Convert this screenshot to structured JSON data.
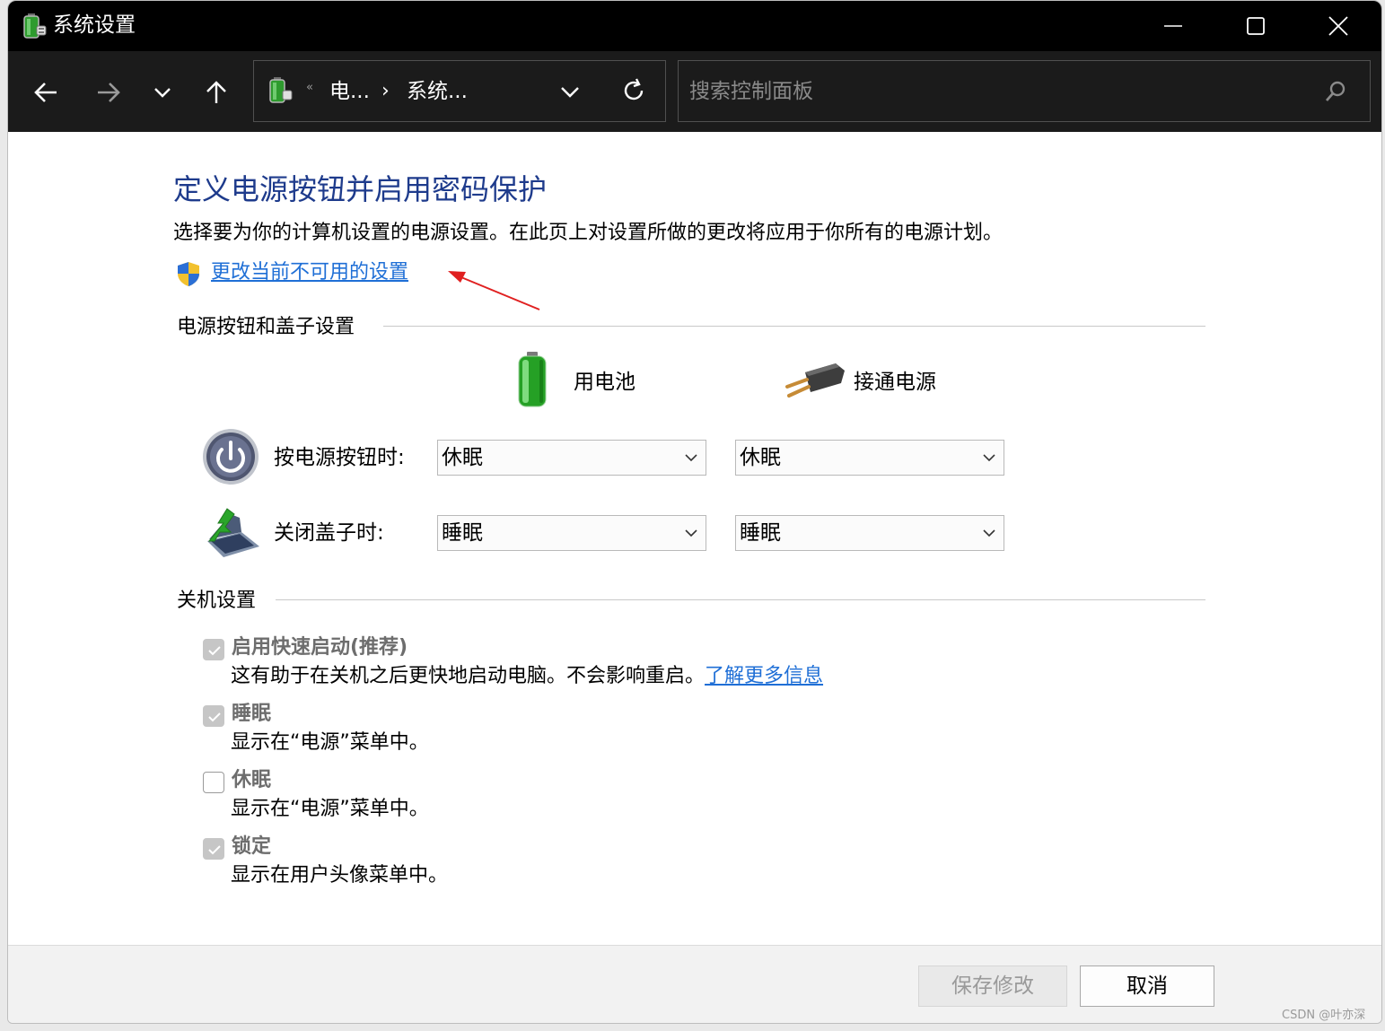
{
  "window": {
    "title": "系统设置",
    "controls": [
      "minimize",
      "maximize",
      "close"
    ]
  },
  "navbar": {
    "address": {
      "overflow": "«",
      "crumb1": "电...",
      "separator": "›",
      "crumb2": "系统..."
    },
    "search_placeholder": "搜索控制面板"
  },
  "content": {
    "heading": "定义电源按钮并启用密码保护",
    "description": "选择要为你的计算机设置的电源设置。在此页上对设置所做的更改将应用于你所有的电源计划。",
    "change_link": "更改当前不可用的设置",
    "power_section": {
      "title": "电源按钮和盖子设置",
      "col_battery": "用电池",
      "col_plugged": "接通电源",
      "rows": [
        {
          "label": "按电源按钮时:",
          "battery": "休眠",
          "plugged": "休眠"
        },
        {
          "label": "关闭盖子时:",
          "battery": "睡眠",
          "plugged": "睡眠"
        }
      ]
    },
    "shutdown_section": {
      "title": "关机设置",
      "options": [
        {
          "title": "启用快速启动(推荐)",
          "desc": "这有助于在关机之后更快地启动电脑。不会影响重启。",
          "link": "了解更多信息",
          "checked": true
        },
        {
          "title": "睡眠",
          "desc": "显示在“电源”菜单中。",
          "checked": true
        },
        {
          "title": "休眠",
          "desc": "显示在“电源”菜单中。",
          "checked": false
        },
        {
          "title": "锁定",
          "desc": "显示在用户头像菜单中。",
          "checked": true
        }
      ]
    }
  },
  "footer": {
    "save_label": "保存修改",
    "cancel_label": "取消"
  },
  "watermark": "CSDN @叶亦深",
  "colors": {
    "heading": "#1e3b8c",
    "link": "#1f6fd6",
    "titlebar": "#000000",
    "navbar": "#1b1b1b"
  }
}
